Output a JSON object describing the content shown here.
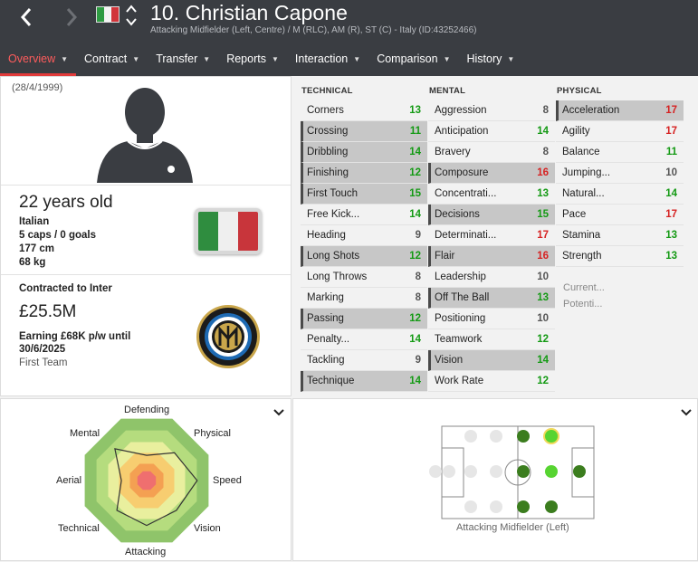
{
  "header": {
    "title": "10. Christian Capone",
    "subtitle": "Attacking Midfielder (Left, Centre) / M (RLC), AM (R), ST (C) - Italy (ID:43252466)",
    "back_icon": "chevron-left-icon",
    "forward_icon": "chevron-right-icon",
    "nation_flag": "italy-flag",
    "colors": {
      "bar": "#3a3d42",
      "active_tab": "#e23b3b"
    }
  },
  "nav": {
    "tabs": [
      {
        "label": "Overview",
        "active": true
      },
      {
        "label": "Contract"
      },
      {
        "label": "Transfer"
      },
      {
        "label": "Reports"
      },
      {
        "label": "Interaction"
      },
      {
        "label": "Comparison"
      },
      {
        "label": "History"
      }
    ]
  },
  "profile": {
    "dob": "(28/4/1999)",
    "age": "22 years old",
    "nationality": "Italian",
    "caps": "5 caps / 0 goals",
    "height": "177 cm",
    "weight": "68 kg",
    "contracted": "Contracted to Inter",
    "value": "£25.5M",
    "earning": "Earning £68K p/w until 30/6/2025",
    "squad": "First Team"
  },
  "attributes": {
    "technical": {
      "heading": "TECHNICAL",
      "rows": [
        {
          "label": "Corners",
          "value": "13",
          "hl": false
        },
        {
          "label": "Crossing",
          "value": "11",
          "hl": true
        },
        {
          "label": "Dribbling",
          "value": "14",
          "hl": true
        },
        {
          "label": "Finishing",
          "value": "12",
          "hl": true
        },
        {
          "label": "First Touch",
          "value": "15",
          "hl": true
        },
        {
          "label": "Free Kick...",
          "value": "14",
          "hl": false
        },
        {
          "label": "Heading",
          "value": "9",
          "hl": false
        },
        {
          "label": "Long Shots",
          "value": "12",
          "hl": true
        },
        {
          "label": "Long Throws",
          "value": "8",
          "hl": false
        },
        {
          "label": "Marking",
          "value": "8",
          "hl": false
        },
        {
          "label": "Passing",
          "value": "12",
          "hl": true
        },
        {
          "label": "Penalty...",
          "value": "14",
          "hl": false
        },
        {
          "label": "Tackling",
          "value": "9",
          "hl": false
        },
        {
          "label": "Technique",
          "value": "14",
          "hl": true
        }
      ]
    },
    "mental": {
      "heading": "MENTAL",
      "rows": [
        {
          "label": "Aggression",
          "value": "8",
          "hl": false
        },
        {
          "label": "Anticipation",
          "value": "14",
          "hl": false
        },
        {
          "label": "Bravery",
          "value": "8",
          "hl": false
        },
        {
          "label": "Composure",
          "value": "16",
          "hl": true
        },
        {
          "label": "Concentrati...",
          "value": "13",
          "hl": false
        },
        {
          "label": "Decisions",
          "value": "15",
          "hl": true
        },
        {
          "label": "Determinati...",
          "value": "17",
          "hl": false
        },
        {
          "label": "Flair",
          "value": "16",
          "hl": true
        },
        {
          "label": "Leadership",
          "value": "10",
          "hl": false
        },
        {
          "label": "Off The Ball",
          "value": "13",
          "hl": true
        },
        {
          "label": "Positioning",
          "value": "10",
          "hl": false
        },
        {
          "label": "Teamwork",
          "value": "12",
          "hl": false
        },
        {
          "label": "Vision",
          "value": "14",
          "hl": true
        },
        {
          "label": "Work Rate",
          "value": "12",
          "hl": false
        }
      ]
    },
    "physical": {
      "heading": "PHYSICAL",
      "rows": [
        {
          "label": "Acceleration",
          "value": "17",
          "hl": true
        },
        {
          "label": "Agility",
          "value": "17",
          "hl": false
        },
        {
          "label": "Balance",
          "value": "11",
          "hl": false
        },
        {
          "label": "Jumping...",
          "value": "10",
          "hl": false
        },
        {
          "label": "Natural...",
          "value": "14",
          "hl": false
        },
        {
          "label": "Pace",
          "value": "17",
          "hl": false
        },
        {
          "label": "Stamina",
          "value": "13",
          "hl": false
        },
        {
          "label": "Strength",
          "value": "13",
          "hl": false
        }
      ]
    },
    "current_label": "Current...",
    "potential_label": "Potenti..."
  },
  "radar": {
    "labels": {
      "defending": "Defending",
      "physical": "Physical",
      "speed": "Speed",
      "vision": "Vision",
      "attacking": "Attacking",
      "technical": "Technical",
      "aerial": "Aerial",
      "mental": "Mental"
    },
    "values": {
      "defending": 0.45,
      "physical": 0.7,
      "speed": 0.9,
      "vision": 0.75,
      "attacking": 0.8,
      "technical": 0.75,
      "aerial": 0.45,
      "mental": 0.8
    }
  },
  "positions": {
    "label": "Attacking Midfielder (Left)"
  }
}
